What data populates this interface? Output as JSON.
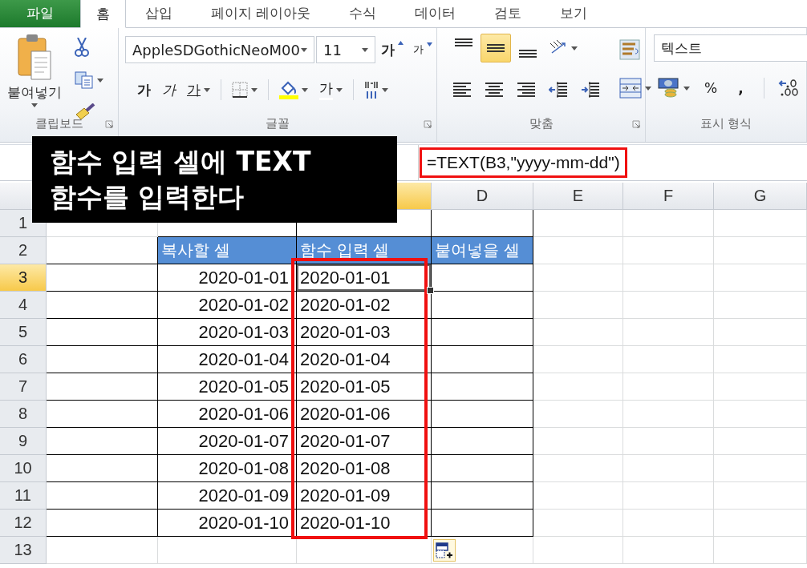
{
  "tabs": [
    {
      "label": "파일",
      "kind": "file",
      "selected": false
    },
    {
      "label": "홈",
      "kind": "tab",
      "selected": true
    },
    {
      "label": "삽입",
      "kind": "tab",
      "selected": false
    },
    {
      "label": "페이지 레이아웃",
      "kind": "tab",
      "selected": false
    },
    {
      "label": "수식",
      "kind": "tab",
      "selected": false
    },
    {
      "label": "데이터",
      "kind": "tab",
      "selected": false
    },
    {
      "label": "검토",
      "kind": "tab",
      "selected": false
    },
    {
      "label": "보기",
      "kind": "tab",
      "selected": false
    }
  ],
  "ribbon": {
    "clipboard": {
      "label": "클립보드",
      "paste_label": "붙여넣기"
    },
    "font": {
      "label": "글꼴",
      "font_name": "AppleSDGothicNeoM00",
      "font_size": "11",
      "grow": "가",
      "shrink": "가",
      "styles": [
        {
          "label": "가",
          "kind": "bold"
        },
        {
          "label": "가",
          "kind": "italic"
        },
        {
          "label": "가",
          "kind": "underline"
        }
      ],
      "font_color": "가"
    },
    "alignment": {
      "label": "맞춤",
      "vertical": [
        {
          "kind": "top",
          "selected": false
        },
        {
          "kind": "middle",
          "selected": true
        },
        {
          "kind": "bottom",
          "selected": false
        }
      ]
    },
    "number": {
      "label": "표시 형식",
      "format": "텍스트",
      "percent": "%",
      "comma": ","
    }
  },
  "formula_bar": {
    "formula": "=TEXT(B3,\"yyyy-mm-dd\")"
  },
  "sheet": {
    "columns": [
      "D",
      "E",
      "F",
      "G"
    ],
    "row_numbers": [
      "1",
      "2",
      "3",
      "4",
      "5",
      "6",
      "7",
      "8",
      "9",
      "10",
      "11",
      "12",
      "13"
    ],
    "table": {
      "headers": [
        "복사할 셀",
        "함수 입력 셀",
        "붙여넣을 셀"
      ],
      "rows": [
        {
          "copy": "2020-01-01",
          "result": "2020-01-01",
          "selected": true
        },
        {
          "copy": "2020-01-02",
          "result": "2020-01-02",
          "selected": false
        },
        {
          "copy": "2020-01-03",
          "result": "2020-01-03",
          "selected": false
        },
        {
          "copy": "2020-01-04",
          "result": "2020-01-04",
          "selected": false
        },
        {
          "copy": "2020-01-05",
          "result": "2020-01-05",
          "selected": false
        },
        {
          "copy": "2020-01-06",
          "result": "2020-01-06",
          "selected": false
        },
        {
          "copy": "2020-01-07",
          "result": "2020-01-07",
          "selected": false
        },
        {
          "copy": "2020-01-08",
          "result": "2020-01-08",
          "selected": false
        },
        {
          "copy": "2020-01-09",
          "result": "2020-01-09",
          "selected": false
        },
        {
          "copy": "2020-01-10",
          "result": "2020-01-10",
          "selected": false
        }
      ]
    }
  },
  "callout": {
    "text": "함수 입력 셀에 TEXT\n함수를 입력한다"
  }
}
